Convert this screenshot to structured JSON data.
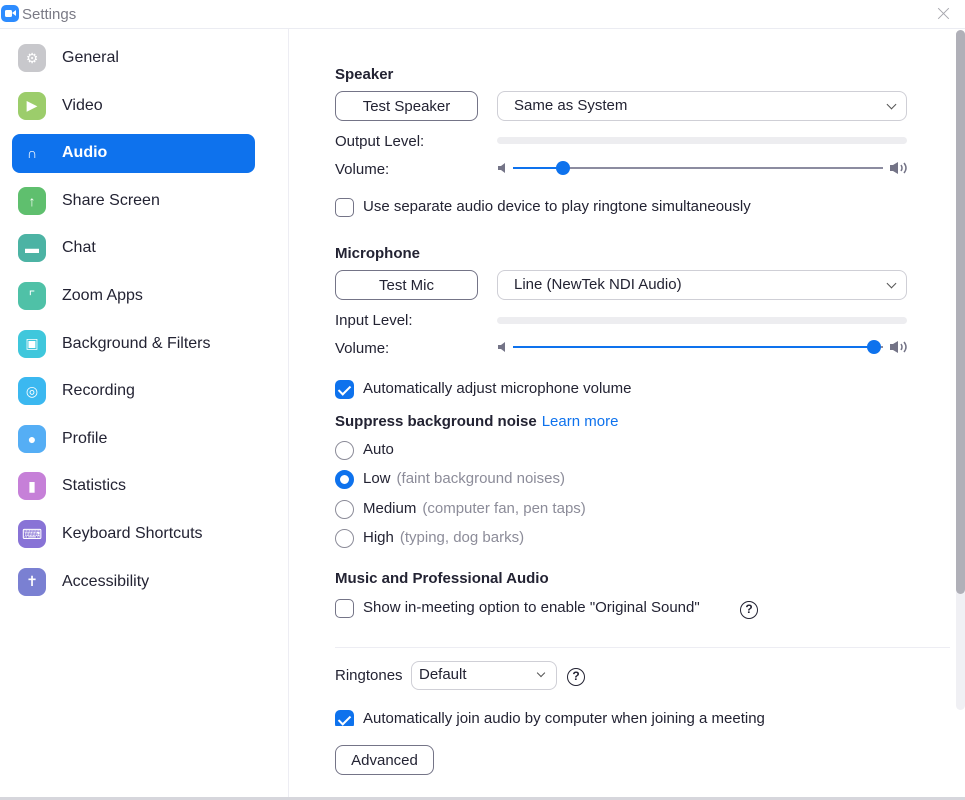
{
  "window": {
    "title": "Settings",
    "app_icon": "zoom-camera-icon",
    "close_icon": "close-icon"
  },
  "sidebar": {
    "active_index": 2,
    "items": [
      {
        "label": "General",
        "icon": "gear-icon",
        "color": "#c8c8cc",
        "glyph": "⚙"
      },
      {
        "label": "Video",
        "icon": "video-camera-icon",
        "color": "#9ccd6b",
        "glyph": "▶"
      },
      {
        "label": "Audio",
        "icon": "headphones-icon",
        "color": "#0e72ed",
        "glyph": "∩"
      },
      {
        "label": "Share Screen",
        "icon": "share-screen-icon",
        "color": "#5fbf6e",
        "glyph": "↑"
      },
      {
        "label": "Chat",
        "icon": "chat-bubble-icon",
        "color": "#4cb3a4",
        "glyph": "▬"
      },
      {
        "label": "Zoom Apps",
        "icon": "zoom-apps-icon",
        "color": "#4fc1a7",
        "glyph": "⌜"
      },
      {
        "label": "Background & Filters",
        "icon": "background-person-icon",
        "color": "#3fc7dc",
        "glyph": "▣"
      },
      {
        "label": "Recording",
        "icon": "record-icon",
        "color": "#3bb8f0",
        "glyph": "◎"
      },
      {
        "label": "Profile",
        "icon": "profile-person-icon",
        "color": "#55aef5",
        "glyph": "●"
      },
      {
        "label": "Statistics",
        "icon": "bar-chart-icon",
        "color": "#c680d8",
        "glyph": "▮"
      },
      {
        "label": "Keyboard Shortcuts",
        "icon": "keyboard-icon",
        "color": "#8873d6",
        "glyph": "⌨"
      },
      {
        "label": "Accessibility",
        "icon": "accessibility-person-icon",
        "color": "#7a80d2",
        "glyph": "✝"
      }
    ]
  },
  "speaker": {
    "title": "Speaker",
    "test_button": "Test Speaker",
    "device": "Same as System",
    "output_level_label": "Output Level:",
    "output_level": 0,
    "volume_label": "Volume:",
    "volume": 0.135
  },
  "ringtone_separate": {
    "label": "Use separate audio device to play ringtone simultaneously",
    "checked": false
  },
  "microphone": {
    "title": "Microphone",
    "test_button": "Test Mic",
    "device": "Line (NewTek NDI Audio)",
    "input_level_label": "Input Level:",
    "input_level": 0,
    "volume_label": "Volume:",
    "volume": 0.975
  },
  "auto_adjust_mic": {
    "label": "Automatically adjust microphone volume",
    "checked": true
  },
  "noise": {
    "title": "Suppress background noise",
    "learn_more": "Learn more",
    "selected": "Low",
    "options": [
      {
        "label": "Auto",
        "hint": ""
      },
      {
        "label": "Low",
        "hint": "(faint background noises)"
      },
      {
        "label": "Medium",
        "hint": "(computer fan, pen taps)"
      },
      {
        "label": "High",
        "hint": "(typing, dog barks)"
      }
    ]
  },
  "music": {
    "title": "Music and Professional Audio",
    "original_sound_label": "Show in-meeting option to enable \"Original Sound\"",
    "checked": false,
    "help": "?"
  },
  "ringtones": {
    "label": "Ringtones",
    "value": "Default",
    "help": "?"
  },
  "auto_join": {
    "label": "Automatically join audio by computer when joining a meeting",
    "checked": true
  },
  "advanced_button": "Advanced",
  "scroll": {
    "thumb_fraction": 0.83,
    "position": 0
  },
  "colors": {
    "accent": "#0e72ed",
    "text": "#232333",
    "muted": "#8c8c99"
  }
}
